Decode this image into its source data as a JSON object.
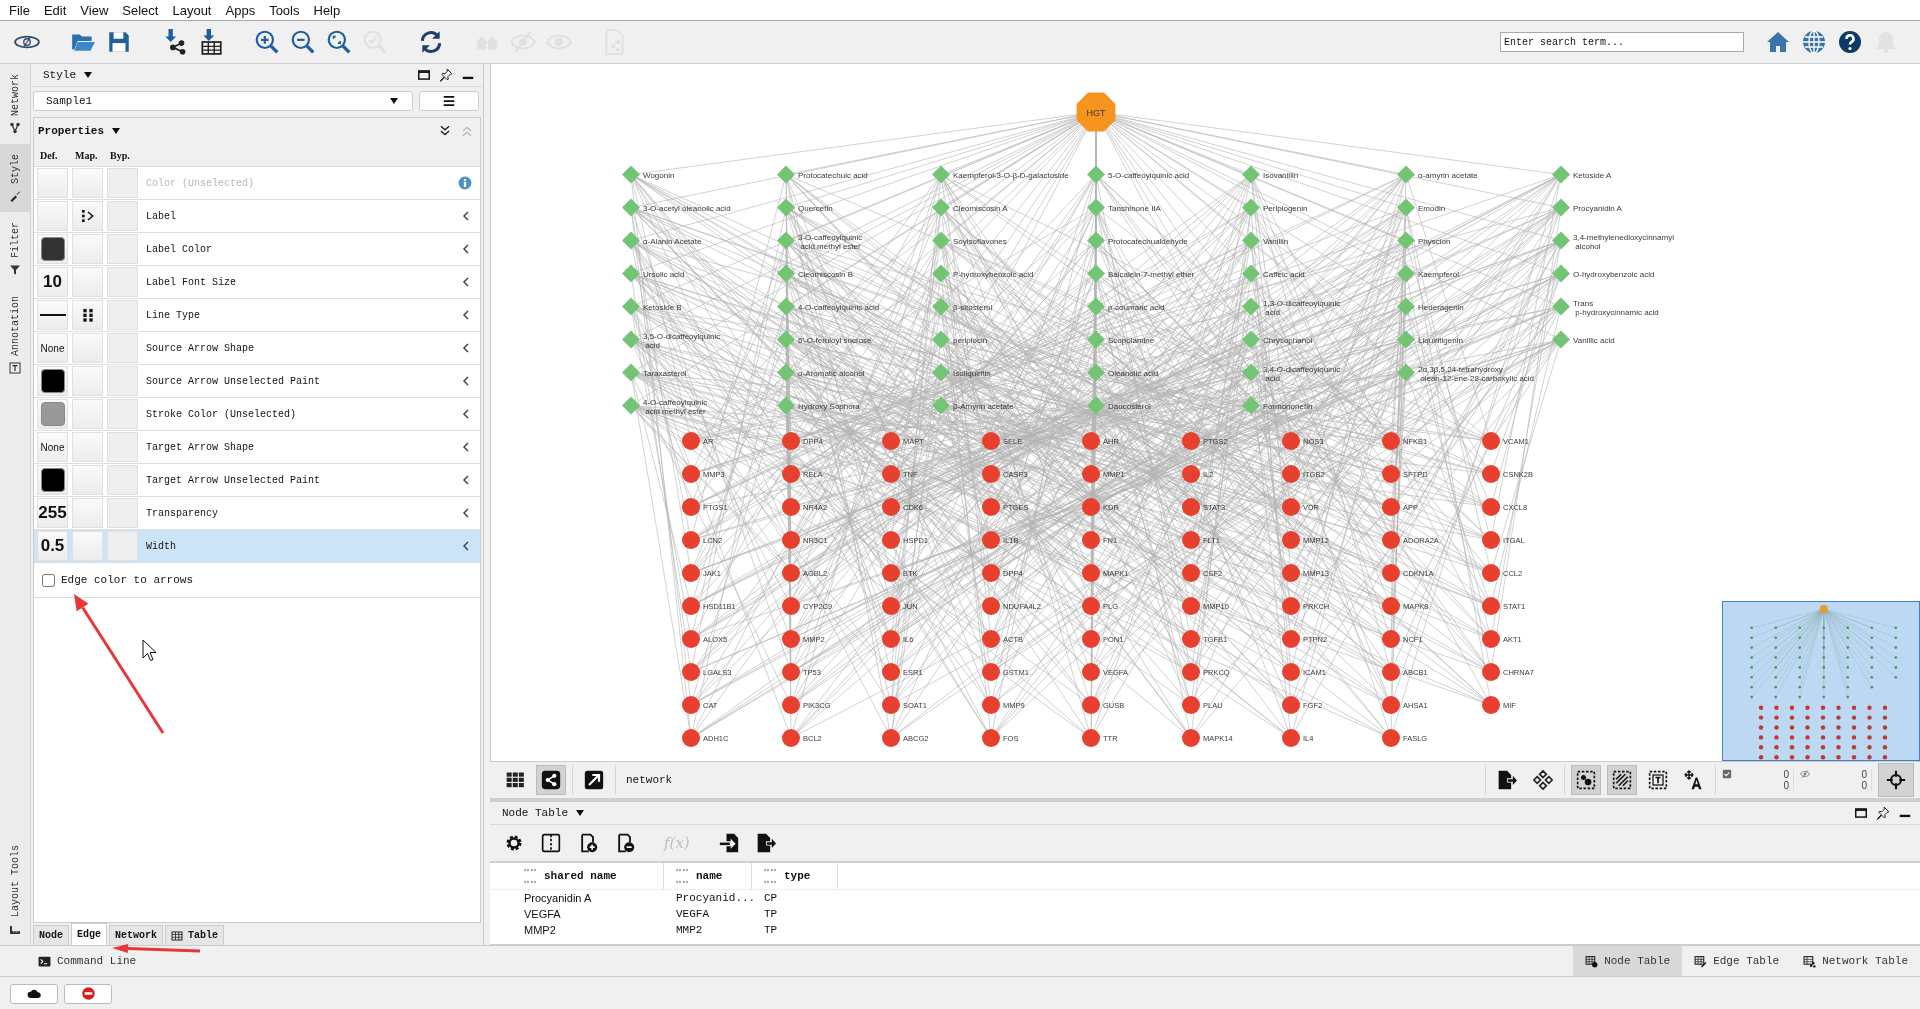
{
  "menu": [
    "File",
    "Edit",
    "View",
    "Select",
    "Layout",
    "Apps",
    "Tools",
    "Help"
  ],
  "toolbar": [
    {
      "kind": "logo",
      "disabled": false
    },
    {
      "kind": "open",
      "disabled": false
    },
    {
      "kind": "save",
      "disabled": false
    },
    {
      "kind": "import-network",
      "disabled": false
    },
    {
      "kind": "import-table",
      "disabled": false
    },
    {
      "kind": "zoom-in",
      "disabled": false
    },
    {
      "kind": "zoom-out",
      "disabled": false
    },
    {
      "kind": "zoom-fit",
      "disabled": false
    },
    {
      "kind": "zoom-selected",
      "disabled": true
    },
    {
      "kind": "refresh",
      "disabled": false
    },
    {
      "kind": "houses",
      "disabled": true
    },
    {
      "kind": "hide",
      "disabled": true
    },
    {
      "kind": "show",
      "disabled": true
    },
    {
      "kind": "document",
      "disabled": true
    }
  ],
  "search": {
    "placeholder": "Enter search term..."
  },
  "toolbar_right": [
    {
      "kind": "home",
      "disabled": false
    },
    {
      "kind": "globe",
      "disabled": false
    },
    {
      "kind": "help",
      "disabled": false
    },
    {
      "kind": "bell",
      "disabled": true
    }
  ],
  "side_tabs": [
    {
      "label": "Network",
      "kind": "network",
      "selected": false
    },
    {
      "label": "Style",
      "kind": "style",
      "selected": true
    },
    {
      "label": "Filter",
      "kind": "filter",
      "selected": false
    },
    {
      "label": "Annotation",
      "kind": "annotation",
      "selected": false
    }
  ],
  "layout_tools": {
    "label": "Layout Tools"
  },
  "style_panel": {
    "title": "Style",
    "style_name": "Sample1",
    "properties_title": "Properties",
    "columns": [
      "Def.",
      "Map.",
      "Byp."
    ],
    "properties": [
      {
        "name": "Color (Unselected)",
        "def": {
          "kind": "blank"
        },
        "disabled": true,
        "selected": false
      },
      {
        "name": "Label",
        "def": {
          "kind": "blank"
        },
        "map": {
          "kind": "passthrough"
        },
        "disabled": false,
        "selected": false
      },
      {
        "name": "Label Color",
        "def": {
          "kind": "swatch",
          "color": "#333333"
        },
        "disabled": false,
        "selected": false
      },
      {
        "name": "Label Font Size",
        "def": {
          "kind": "number",
          "value": "10"
        },
        "disabled": false,
        "selected": false
      },
      {
        "name": "Line Type",
        "def": {
          "kind": "line"
        },
        "map": {
          "kind": "discrete"
        },
        "disabled": false,
        "selected": false
      },
      {
        "name": "Source Arrow Shape",
        "def": {
          "kind": "text",
          "value": "None"
        },
        "disabled": false,
        "selected": false
      },
      {
        "name": "Source Arrow Unselected Paint",
        "def": {
          "kind": "swatch",
          "color": "#000000"
        },
        "disabled": false,
        "selected": false
      },
      {
        "name": "Stroke Color (Unselected)",
        "def": {
          "kind": "swatch",
          "color": "#999999"
        },
        "disabled": false,
        "selected": false
      },
      {
        "name": "Target Arrow Shape",
        "def": {
          "kind": "text",
          "value": "None"
        },
        "disabled": false,
        "selected": false
      },
      {
        "name": "Target Arrow Unselected Paint",
        "def": {
          "kind": "swatch",
          "color": "#000000"
        },
        "disabled": false,
        "selected": false
      },
      {
        "name": "Transparency",
        "def": {
          "kind": "number",
          "value": "255"
        },
        "disabled": false,
        "selected": false
      },
      {
        "name": "Width",
        "def": {
          "kind": "number",
          "value": "0.5"
        },
        "disabled": false,
        "selected": true
      }
    ],
    "edge_color_to_arrows": {
      "label": "Edge color to arrows",
      "checked": false
    },
    "tabs": [
      {
        "label": "Node",
        "kind": "plain",
        "selected": false
      },
      {
        "label": "Edge",
        "kind": "plain",
        "selected": true
      },
      {
        "label": "Network",
        "kind": "plain",
        "selected": false
      },
      {
        "label": "Table",
        "kind": "table",
        "selected": false
      }
    ]
  },
  "network": {
    "hub": "HGT",
    "compounds": [
      [
        "Wogonin",
        "Protocatechuic acid",
        "Kaempferol-3-O-β-D-galactoside",
        "5-O-caffeoylquinic acid",
        "Isovanillin",
        "α-amyrin acetate",
        "Ketoside A"
      ],
      [
        "3-O-acetyl oleanolic acid",
        "Quercetin",
        "Cleomiscosin A",
        "Tanshinone IIA",
        "Periplogenin",
        "Emodin",
        "Procyanidin A"
      ],
      [
        "α-Alanin Acetate",
        "3-O-caffeoylquinic acid methyl ester",
        "Soyisoflavones",
        "Protocatechualdehyde",
        "Vanillin",
        "Physcion",
        "3,4-methylenedioxycinnamyl alcohol"
      ],
      [
        "Ursolic acid",
        "Cleomiscosin B",
        "P-hydroxybenzoic acid",
        "Baicalein-7-methyl ether",
        "Caffeic acid",
        "Kaempferol",
        "O-hydroxybenzoic acid"
      ],
      [
        "Ketoside B",
        "4-O-caffeoylquinic acid",
        "β-sitosterol",
        "p-coumaric acid",
        "1,3-O-dicaffeoylquinic acid",
        "Hederagenin",
        "Trans p-hydroxycinnamic acid"
      ],
      [
        "3,5-O-dicaffeoylquinic acid",
        "6'-O-feruloyl sucrose",
        "periplocin",
        "Scopolamine",
        "Chrysophanol",
        "Liquiritigenin",
        "Vanillic acid"
      ],
      [
        "Taraxasterol",
        "α-Aromatic alcohol",
        "Isoliquiritin",
        "Oleanolic acid",
        "3,4-O-dicaffeoylquinic acid",
        "2α,3β,5,24-tetrahydroxy olean-12-ene-28-carboxylic acid"
      ],
      [
        "4-O-caffeoylquinic acid methyl ester",
        "Hydroxy Sophora",
        "β-Amyrin acetate",
        "Daucosterol",
        "Formononetin"
      ]
    ],
    "targets": [
      [
        "AR",
        "MMP3",
        "PTGS1",
        "LCN2",
        "JAK1",
        "HSD11B1",
        "ALOX5",
        "LGALS3",
        "CAT",
        "ADH1C"
      ],
      [
        "DPP4",
        "RELA",
        "NR4A2",
        "NR3C1",
        "AGBL2",
        "CYP2C9",
        "MMP2",
        "TP53",
        "PIK3CG",
        "BCL2"
      ],
      [
        "MAPT",
        "TNF",
        "CDK6",
        "HSPD1",
        "BTK",
        "JUN",
        "IL6",
        "ESR1",
        "SOAT1",
        "ABCG2"
      ],
      [
        "SELE",
        "CASP3",
        "PTGES",
        "IL1B",
        "DPP4",
        "NDUFA4L2",
        "ACTB",
        "GSTM1",
        "MMP9",
        "FOS"
      ],
      [
        "AHR",
        "MMP1",
        "KDR",
        "FN1",
        "MAPK1",
        "PLG",
        "PON1",
        "VEGFA",
        "GUSB",
        "TTR"
      ],
      [
        "PTGS2",
        "IL2",
        "STAT3",
        "FLT1",
        "CSF2",
        "MMP10",
        "TGFB1",
        "PRKCQ",
        "PLAU",
        "MAPK14"
      ],
      [
        "NOS3",
        "ITGB2",
        "VDR",
        "MMP12",
        "MMP13",
        "PRKCH",
        "PTPN2",
        "ICAM1",
        "FGF2",
        "IL4"
      ],
      [
        "NFKB1",
        "SFTPD",
        "APP",
        "ADORA2A",
        "CDKN1A",
        "MAPK8",
        "NCF1",
        "ABCB1",
        "AHSA1",
        "FASLG"
      ],
      [
        "VCAM1",
        "CSNK2B",
        "CXCL8",
        "ITGAL",
        "CCL2",
        "STAT1",
        "AKT1",
        "CHRNA7",
        "MIF"
      ]
    ]
  },
  "network_toolbar": {
    "left": [
      {
        "kind": "grid",
        "selected": false
      },
      {
        "kind": "share",
        "selected": true
      },
      {
        "kind": "detach",
        "selected": false
      }
    ],
    "title": "network",
    "right": [
      {
        "kind": "export",
        "selected": false
      },
      {
        "kind": "layout",
        "selected": false
      },
      {
        "kind": "select-nodes",
        "selected": true
      },
      {
        "kind": "select-edges",
        "selected": true
      },
      {
        "kind": "text-annotation",
        "selected": false
      },
      {
        "kind": "move-label",
        "selected": false
      }
    ],
    "selected_counts": [
      "0",
      "0"
    ],
    "hidden_counts": [
      "0",
      "0"
    ],
    "fit_selected": true
  },
  "table_panel": {
    "title": "Node Table",
    "tools": [
      {
        "kind": "gear",
        "disabled": false
      },
      {
        "kind": "columns",
        "disabled": false
      },
      {
        "kind": "add",
        "disabled": false
      },
      {
        "kind": "remove",
        "disabled": false
      },
      {
        "kind": "function",
        "label": "f(x)",
        "disabled": true
      },
      {
        "kind": "import",
        "disabled": false
      },
      {
        "kind": "export",
        "disabled": false
      }
    ],
    "columns": [
      "shared name",
      "name",
      "type"
    ],
    "rows": [
      [
        "Procyanidin A",
        "Procyanid...",
        "CP"
      ],
      [
        "VEGFA",
        "VEGFA",
        "TP"
      ],
      [
        "MMP2",
        "MMP2",
        "TP"
      ]
    ]
  },
  "command_line": "Command Line",
  "table_tabs": [
    {
      "label": "Node Table",
      "selected": true
    },
    {
      "label": "Edge Table",
      "selected": false
    },
    {
      "label": "Network Table",
      "selected": false
    }
  ],
  "status_buttons": [
    {
      "kind": "cloud"
    },
    {
      "kind": "stop"
    }
  ],
  "annotations": [
    {
      "kind": "arrow"
    },
    {
      "kind": "arrow"
    },
    {
      "kind": "cursor"
    }
  ]
}
